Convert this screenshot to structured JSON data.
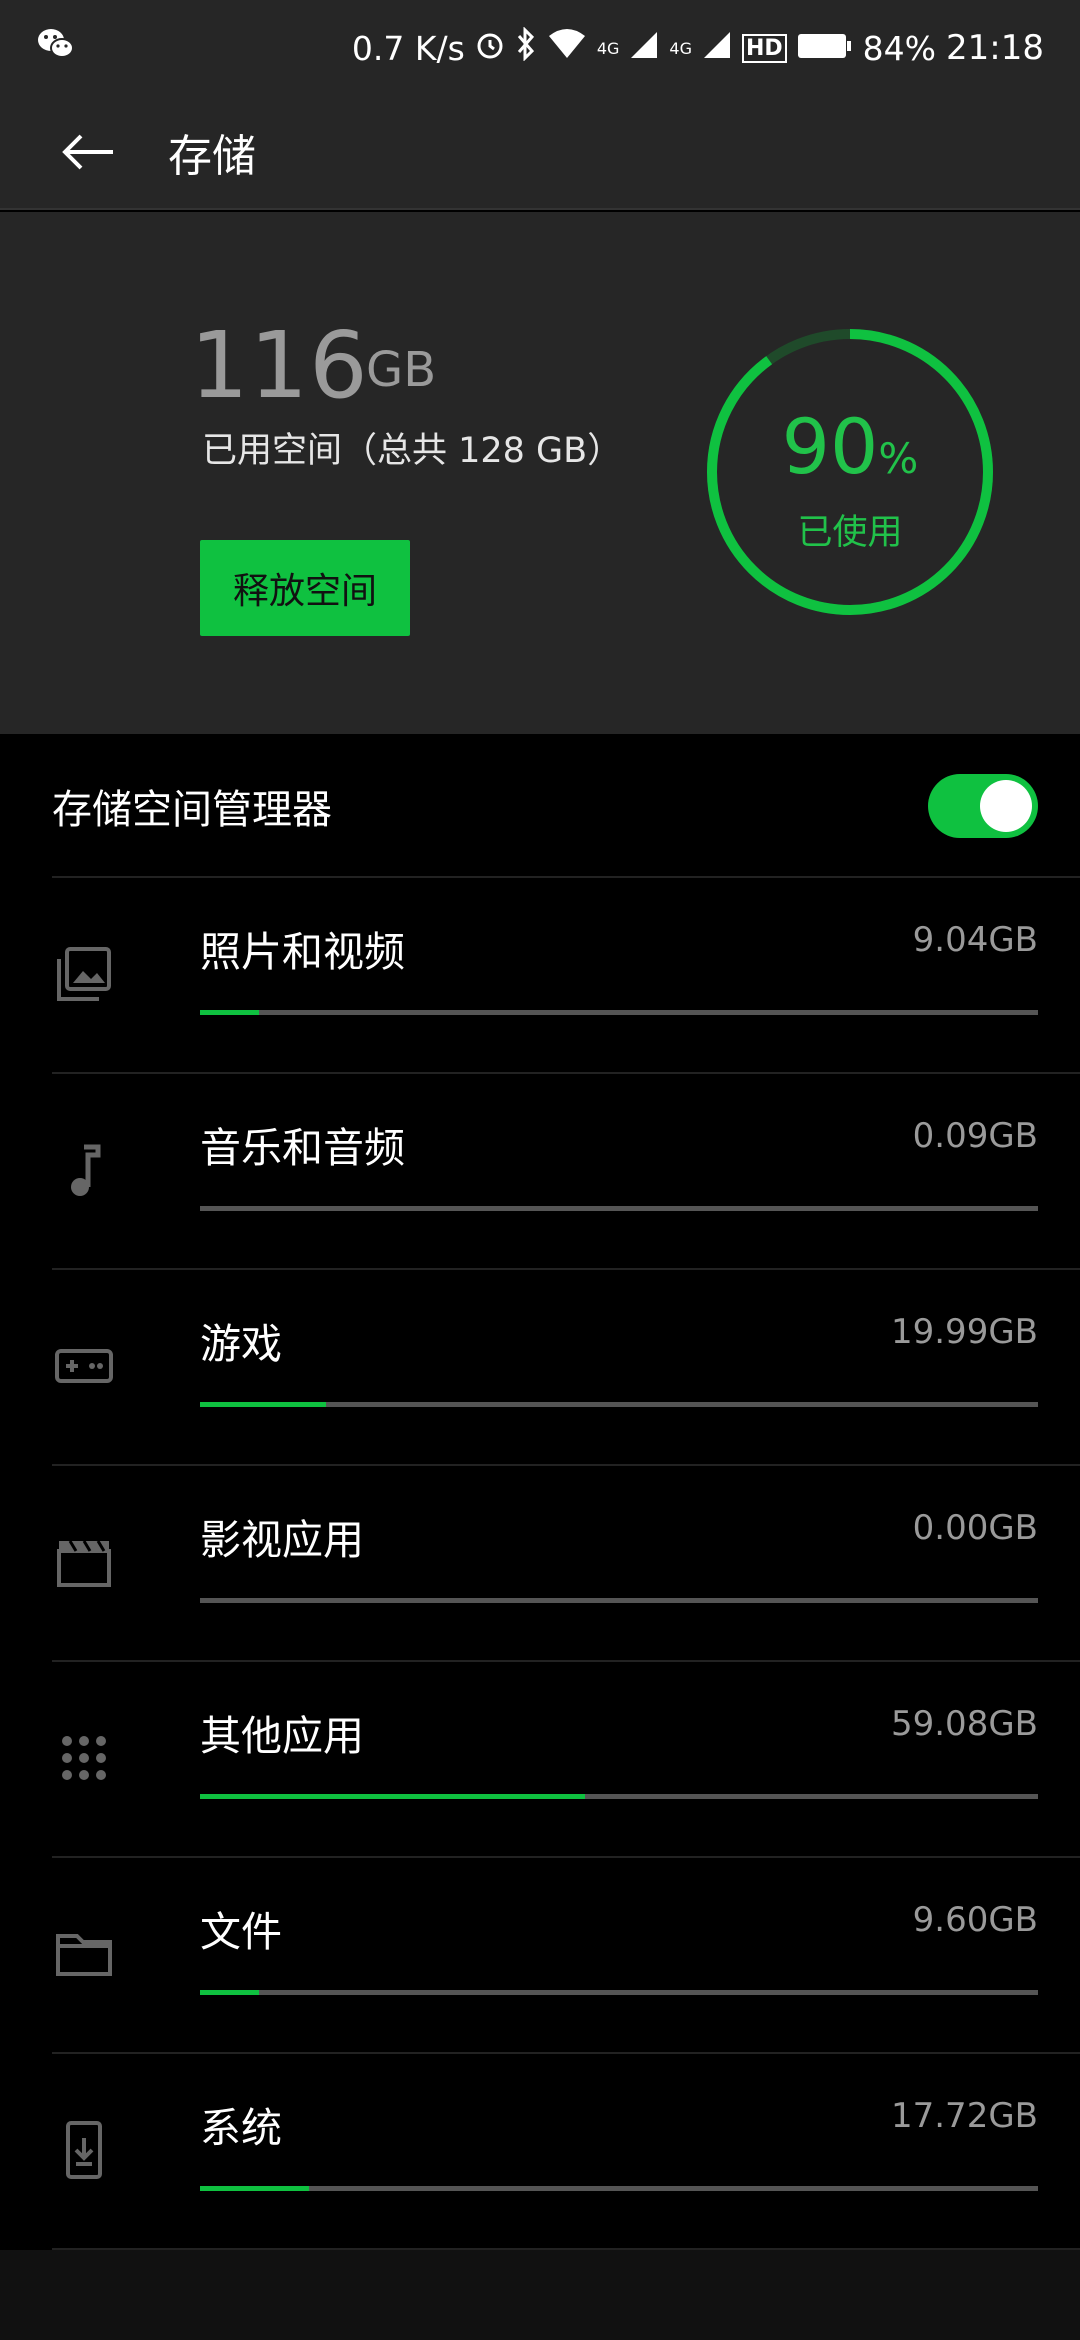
{
  "status_bar": {
    "speed": "0.7 K/s",
    "network1": "4G",
    "network2": "4G",
    "hd": "HD",
    "battery": "84%",
    "time": "21:18"
  },
  "app_bar": {
    "title": "存储"
  },
  "summary": {
    "used_value": "116",
    "used_unit": "GB",
    "used_desc": "已用空间（总共 128 GB）",
    "free_button": "释放空间",
    "percent_value": "90",
    "percent_sign": "%",
    "percent_label": "已使用",
    "used_fraction": 0.9
  },
  "manager": {
    "label": "存储空间管理器",
    "enabled": true
  },
  "categories": [
    {
      "name": "照片和视频",
      "size": "9.04GB",
      "fraction": 0.07,
      "icon": "photo-icon"
    },
    {
      "name": "音乐和音频",
      "size": "0.09GB",
      "fraction": 0.0,
      "icon": "music-note-icon"
    },
    {
      "name": "游戏",
      "size": "19.99GB",
      "fraction": 0.15,
      "icon": "gamepad-icon"
    },
    {
      "name": "影视应用",
      "size": "0.00GB",
      "fraction": 0.0,
      "icon": "clapperboard-icon"
    },
    {
      "name": "其他应用",
      "size": "59.08GB",
      "fraction": 0.46,
      "icon": "app-grid-icon"
    },
    {
      "name": "文件",
      "size": "9.60GB",
      "fraction": 0.07,
      "icon": "folder-icon"
    },
    {
      "name": "系统",
      "size": "17.72GB",
      "fraction": 0.13,
      "icon": "system-update-icon"
    }
  ],
  "colors": {
    "accent": "#0fc140",
    "background": "#000000",
    "panel": "#262626"
  }
}
